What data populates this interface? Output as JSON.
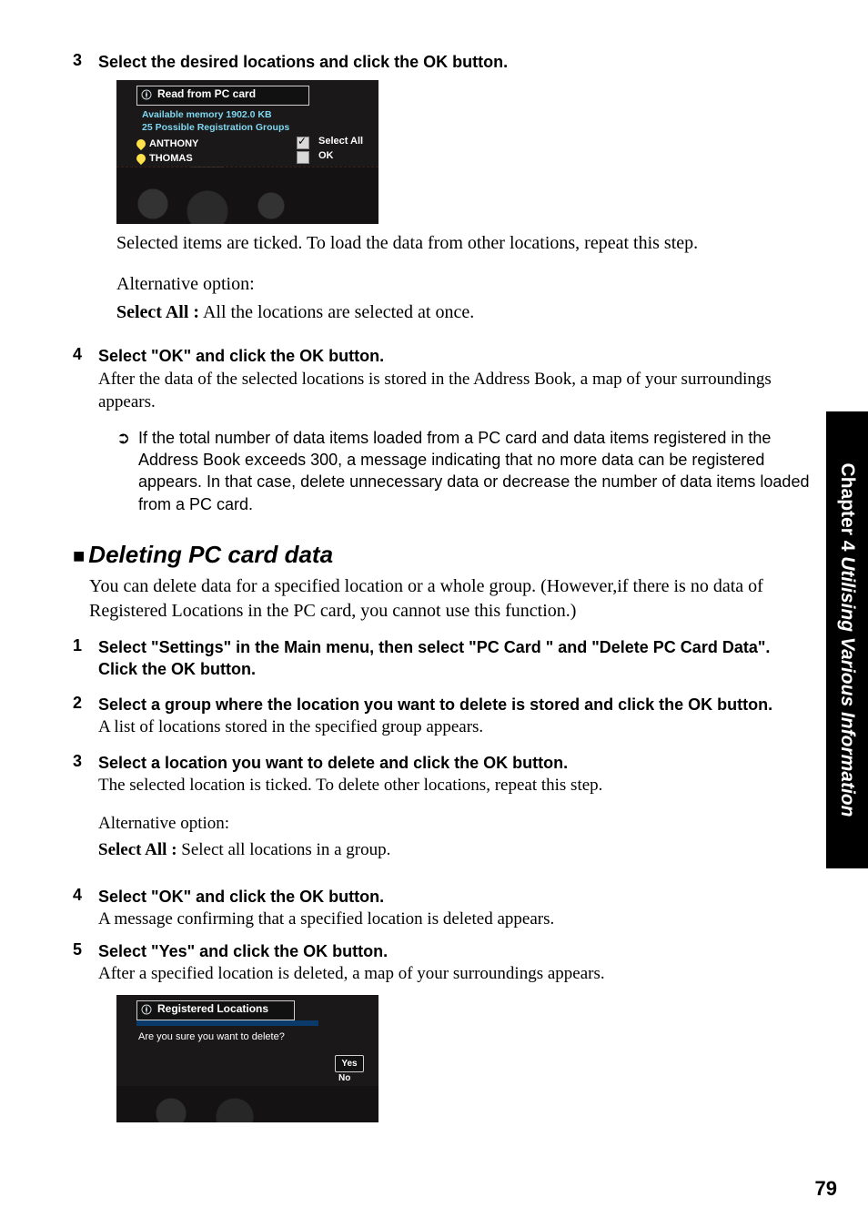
{
  "step3": {
    "num": "3",
    "head": "Select the desired locations and click the OK button.",
    "p1": "Selected items are ticked. To load the data from other locations, repeat this step.",
    "p2": "Alternative option:",
    "opt_label": "Select All :",
    "opt_text": "  All the locations are selected at once."
  },
  "shot1": {
    "title": "Read from PC card",
    "info1": "Available memory 1902.0 KB",
    "info2": "25 Possible Registration Groups",
    "row1": "ANTHONY",
    "row2": "THOMAS",
    "btn1": "Select All",
    "btn2": "OK"
  },
  "step4": {
    "num": "4",
    "head": "Select \"OK\" and click the OK button.",
    "p1": "After the data of the selected locations is stored in the Address Book, a map of your surroundings appears."
  },
  "note": {
    "text": "If the total number of data items loaded from a PC card and data items registered in the Address Book exceeds 300, a message indicating that no more data can be registered appears. In that case, delete unnecessary data or decrease the number of data items loaded from a PC card."
  },
  "section": {
    "title": "Deleting PC card data",
    "intro": "You can delete data for a specified location or a whole group. (However,if there is no data of Registered Locations in the PC card, you cannot use this function.)"
  },
  "d1": {
    "num": "1",
    "head": "Select \"Settings\" in the Main menu, then select \"PC Card \" and \"Delete PC Card Data\". Click the OK button."
  },
  "d2": {
    "num": "2",
    "head": "Select a group where the location you want to delete is stored and click the OK button.",
    "p1": "A list of locations stored in the specified group appears."
  },
  "d3": {
    "num": "3",
    "head": "Select a location you want to delete and click the OK button.",
    "p1": "The selected location is ticked. To delete other locations, repeat this step.",
    "p2": "Alternative option:",
    "opt_label": "Select All :",
    "opt_text": "  Select all locations in a group."
  },
  "d4": {
    "num": "4",
    "head": "Select \"OK\" and click the OK button.",
    "p1": "A message confirming that a specified location is deleted appears."
  },
  "d5": {
    "num": "5",
    "head": "Select \"Yes\" and click the OK button.",
    "p1": "After a specified location is deleted, a map of your surroundings appears."
  },
  "shot2": {
    "title": "Registered  Locations",
    "msg": "Are you sure you want to delete?",
    "yes": "Yes",
    "no": "No"
  },
  "side": {
    "chapter": "Chapter 4",
    "title": " Utilising Various Information"
  },
  "page_number": "79"
}
